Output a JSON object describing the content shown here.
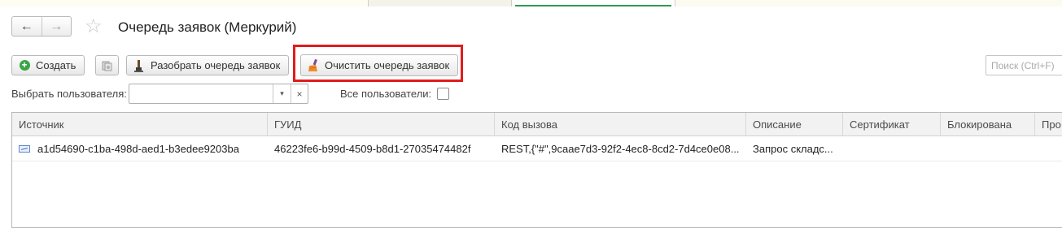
{
  "window": {
    "title": "Очередь заявок (Меркурий)"
  },
  "nav": {
    "back_icon": "←",
    "forward_icon": "→",
    "favorite_icon": "☆"
  },
  "toolbar": {
    "create_label": "Создать",
    "create_icon": "+",
    "parse_label": "Разобрать очередь заявок",
    "clear_label": "Очистить очередь заявок",
    "search_placeholder": "Поиск (Ctrl+F)"
  },
  "filter": {
    "user_label": "Выбрать пользователя:",
    "user_value": "",
    "dropdown_icon": "▾",
    "clear_icon": "×",
    "all_users_label": "Все пользователи:",
    "all_users_checked": false
  },
  "table": {
    "columns": [
      "Источник",
      "ГУИД",
      "Код вызова",
      "Описание",
      "Сертификат",
      "Блокирована",
      "Про"
    ],
    "rows": [
      {
        "source": "a1d54690-c1ba-498d-aed1-b3edee9203ba",
        "guid": "46223fe6-b99d-4509-b8d1-27035474482f",
        "call_code": "REST,{\"#\",9caae7d3-92f2-4ec8-8cd2-7d4ce0e08...",
        "description": "Запрос складс...",
        "certificate": "",
        "blocked": "",
        "extra": ""
      }
    ]
  },
  "colors": {
    "highlight_border": "#e21c1c",
    "create_icon_bg": "#3ba545",
    "active_tab_underline": "#2e9b4e"
  }
}
